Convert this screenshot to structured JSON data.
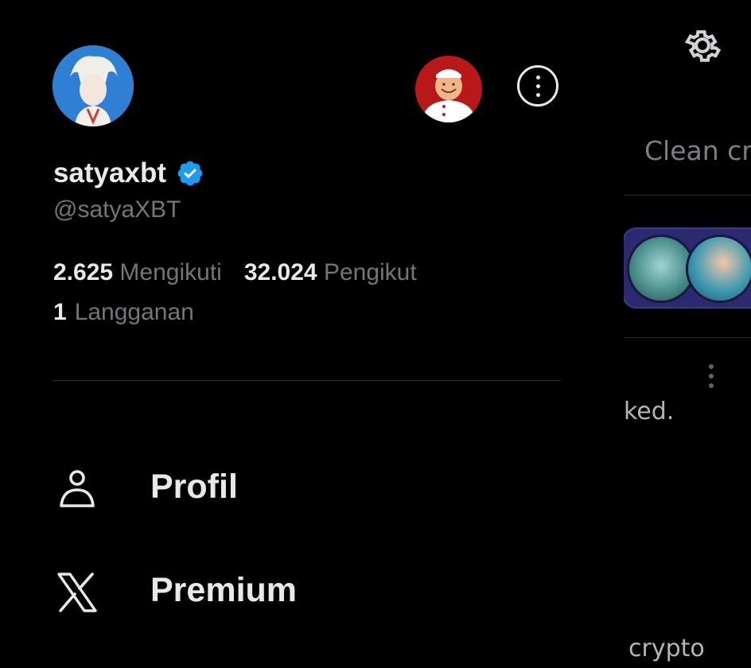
{
  "background": {
    "tab_label": "Clean cr",
    "snippet_1": "ked.",
    "snippet_2": "crypto"
  },
  "profile": {
    "display_name": "satyaxbt",
    "handle": "@satyaXBT",
    "following_count": "2.625",
    "following_label": "Mengikuti",
    "followers_count": "32.024",
    "followers_label": "Pengikut",
    "subscriptions_count": "1",
    "subscriptions_label": "Langganan",
    "verified": true
  },
  "menu": {
    "items": [
      {
        "label": "Profil",
        "icon": "person-icon"
      },
      {
        "label": "Premium",
        "icon": "x-logo-icon"
      }
    ]
  },
  "colors": {
    "background": "#000000",
    "text_primary": "#e7e9ea",
    "text_secondary": "#71767b",
    "verified_blue": "#1d9bf0",
    "space_card": "#2c2a6e"
  }
}
